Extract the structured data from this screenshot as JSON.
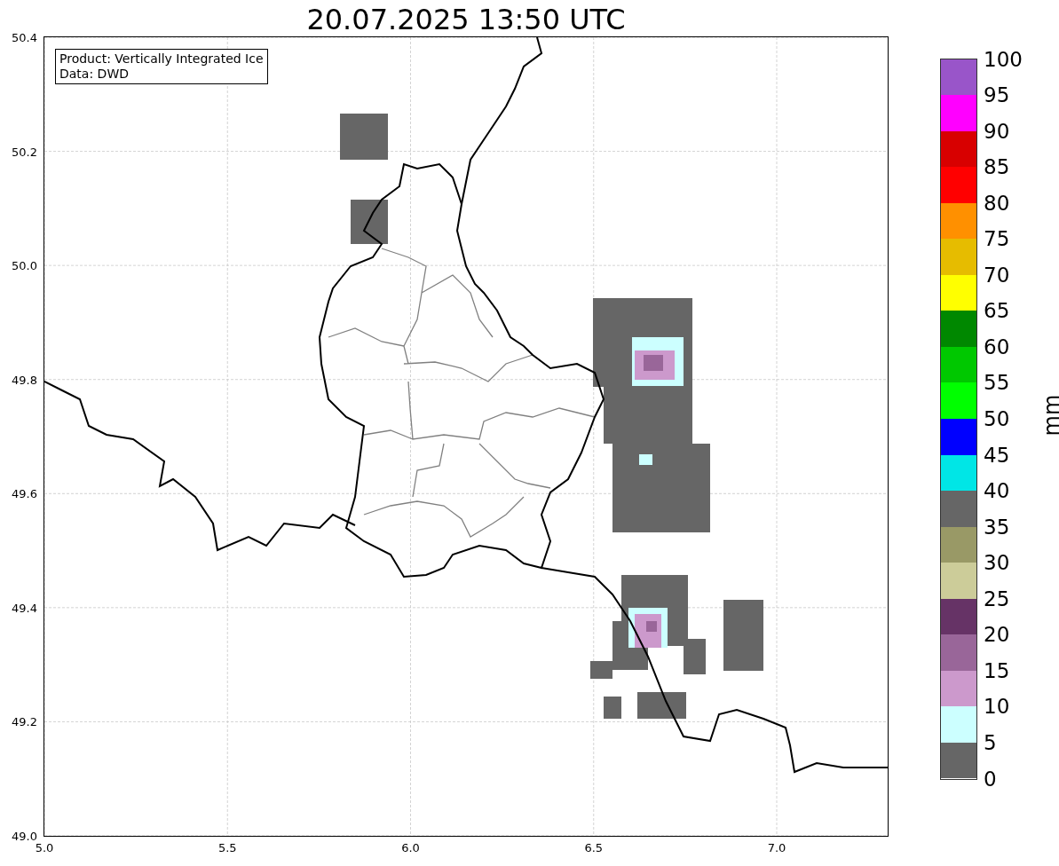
{
  "title": "20.07.2025 13:50 UTC",
  "info_box": [
    "Product: Vertically Integrated Ice",
    "Data: DWD"
  ],
  "x_ticks": [
    "5.0",
    "5.5",
    "6.0",
    "6.5",
    "7.0"
  ],
  "y_ticks": [
    "50.4",
    "50.2",
    "50.0",
    "49.8",
    "49.6",
    "49.4",
    "49.2",
    "49.0"
  ],
  "colorbar": {
    "label": "mm",
    "ticks": [
      "100",
      "95",
      "90",
      "85",
      "80",
      "75",
      "70",
      "65",
      "60",
      "55",
      "50",
      "45",
      "40",
      "35",
      "30",
      "25",
      "20",
      "15",
      "10",
      "5",
      "0"
    ],
    "bands": [
      {
        "color": "#9955c9"
      },
      {
        "color": "#ff00ff"
      },
      {
        "color": "#d80000"
      },
      {
        "color": "#ff0000"
      },
      {
        "color": "#ff9000"
      },
      {
        "color": "#e6bc00"
      },
      {
        "color": "#ffff00"
      },
      {
        "color": "#008800"
      },
      {
        "color": "#00c800"
      },
      {
        "color": "#00ff00"
      },
      {
        "color": "#0000ff"
      },
      {
        "color": "#00e6e6"
      },
      {
        "color": "#666666"
      },
      {
        "color": "#999966"
      },
      {
        "color": "#cccc99"
      },
      {
        "color": "#663366"
      },
      {
        "color": "#996699"
      },
      {
        "color": "#cc99cc"
      },
      {
        "color": "#ccffff"
      },
      {
        "color": "#666666"
      }
    ]
  }
}
